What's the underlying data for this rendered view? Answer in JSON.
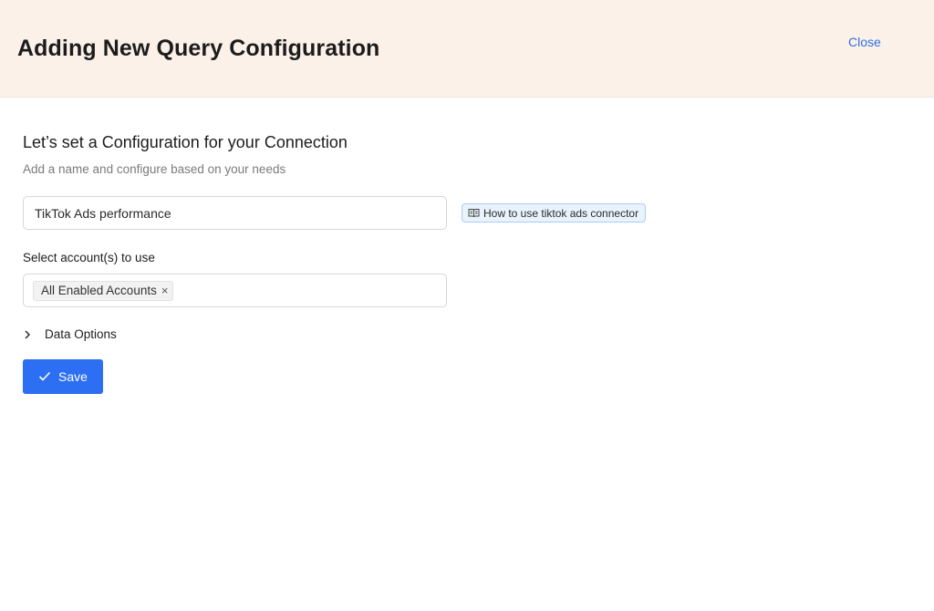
{
  "header": {
    "title": "Adding New Query Configuration",
    "close_label": "Close"
  },
  "form": {
    "title": "Let’s set a Configuration for your Connection",
    "subtitle": "Add a name and configure based on your needs",
    "name_value": "TikTok Ads performance",
    "help_link": {
      "label": "How to use tiktok ads connector",
      "icon": "book-icon"
    },
    "accounts_label": "Select account(s) to use",
    "accounts_selected": [
      "All Enabled Accounts"
    ],
    "data_options_label": "Data Options",
    "save_label": "Save"
  },
  "colors": {
    "header_bg": "#fbf1e9",
    "accent": "#2c6ff2",
    "link": "#2f6fe4",
    "help_chip_bg": "#e9f3fd",
    "help_chip_border": "#a9cdf3"
  }
}
